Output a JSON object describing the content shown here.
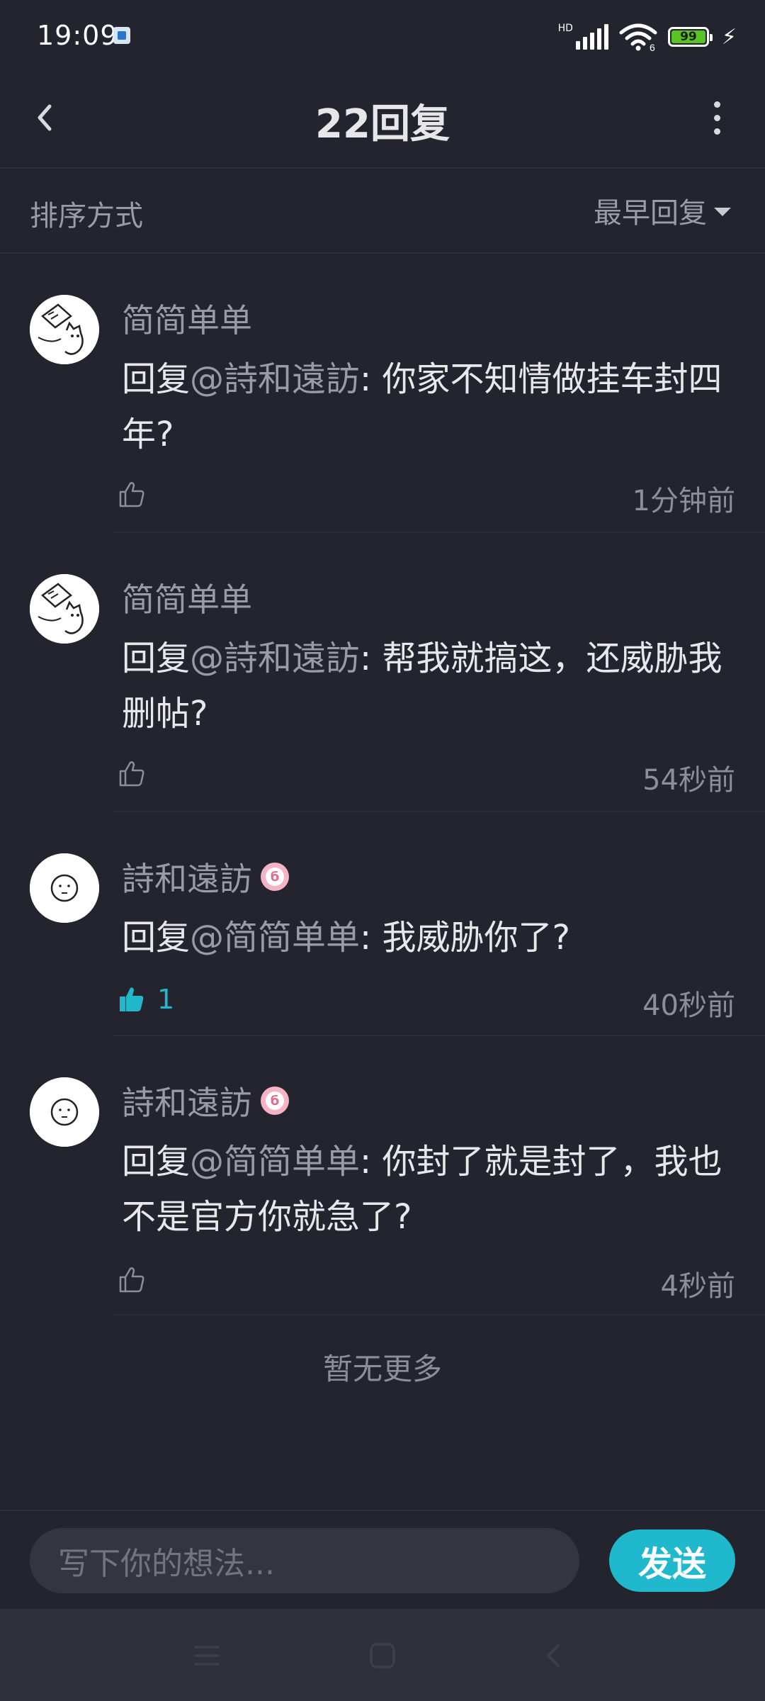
{
  "status_bar": {
    "time": "19:09",
    "network_label": "HD",
    "wifi_label": "6",
    "battery": "99"
  },
  "header": {
    "title": "22回复"
  },
  "sort": {
    "label": "排序方式",
    "selected": "最早回复"
  },
  "comments": [
    {
      "author": "简简单单",
      "reply_prefix": "回复",
      "mention": "@詩和遠訪",
      "text": ": 你家不知情做挂车封四年?",
      "time": "1分钟前",
      "likes": "",
      "liked": false
    },
    {
      "author": "简简单单",
      "reply_prefix": "回复",
      "mention": "@詩和遠訪",
      "text": ": 帮我就搞这，还威胁我删帖?",
      "time": "54秒前",
      "likes": "",
      "liked": false
    },
    {
      "author": "詩和遠訪",
      "reply_prefix": "回复",
      "mention": "@简简单单",
      "text": ": 我威胁你了?",
      "time": "40秒前",
      "likes": "1",
      "liked": true
    },
    {
      "author": "詩和遠訪",
      "reply_prefix": "回复",
      "mention": "@简简单单",
      "text": ": 你封了就是封了，我也不是官方你就急了?",
      "time": "4秒前",
      "likes": "",
      "liked": false
    }
  ],
  "footer_note": "暂无更多",
  "composer": {
    "placeholder": "写下你的想法...",
    "send_label": "发送"
  },
  "colors": {
    "background": "#23242d",
    "accent": "#1fb8cc",
    "muted_text": "#9a9ba3"
  }
}
